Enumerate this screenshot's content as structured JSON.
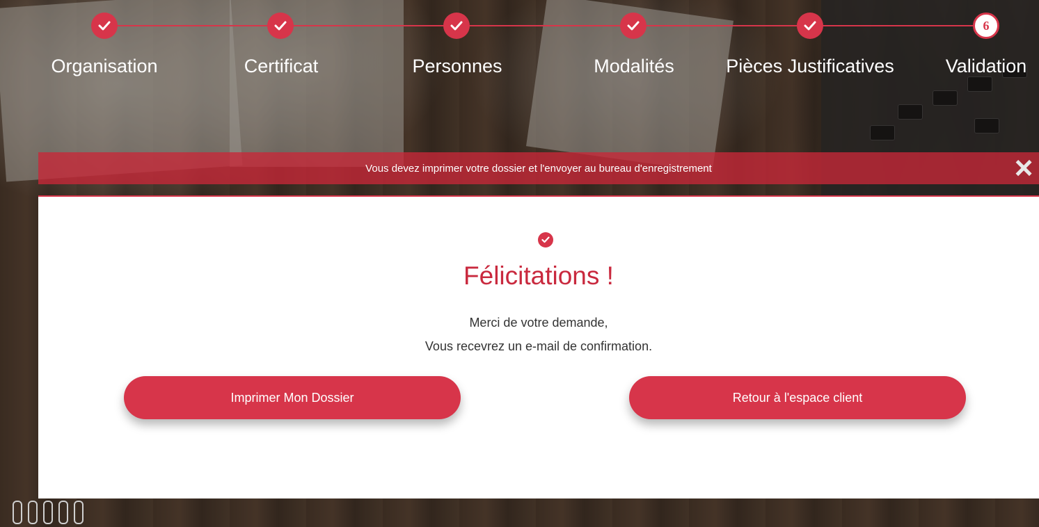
{
  "stepper": {
    "steps": [
      {
        "label": "Organisation",
        "state": "done"
      },
      {
        "label": "Certificat",
        "state": "done"
      },
      {
        "label": "Personnes",
        "state": "done"
      },
      {
        "label": "Modalités",
        "state": "done"
      },
      {
        "label": "Pièces Justificatives",
        "state": "done"
      },
      {
        "label": "Validation",
        "state": "current",
        "number": "6"
      }
    ]
  },
  "alert": {
    "message": "Vous devez imprimer votre dossier et l'envoyer au bureau d'enregistrement",
    "close_icon": "×"
  },
  "confirmation": {
    "title": "Félicitations !",
    "line1": "Merci de votre demande,",
    "line2": "Vous recevrez un e-mail de confirmation."
  },
  "actions": {
    "print_label": "Imprimer Mon Dossier",
    "back_label": "Retour à l'espace client"
  },
  "colors": {
    "accent": "#d7354a",
    "title": "#c9293e"
  },
  "icons": {
    "done_step": "check-icon",
    "success": "check-circle-icon",
    "close": "close-icon"
  }
}
